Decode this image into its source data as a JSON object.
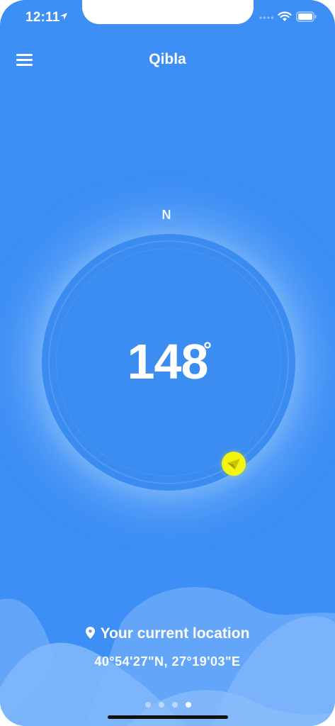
{
  "status_bar": {
    "time": "12:11"
  },
  "header": {
    "title": "Qibla"
  },
  "compass": {
    "north_label": "N",
    "heading": "148",
    "degree_symbol": "°"
  },
  "location": {
    "label": "Your current location",
    "coordinates": "40°54'27\"N, 27°19'03\"E"
  },
  "pager": {
    "count": 4,
    "active_index": 3
  },
  "colors": {
    "background": "#3d8ff5",
    "marker": "#f3f40f",
    "text": "#ffffff"
  },
  "icons": [
    "location-arrow-icon",
    "signal-icon",
    "wifi-icon",
    "battery-icon",
    "menu-icon",
    "qibla-arrow-icon",
    "pin-icon"
  ]
}
